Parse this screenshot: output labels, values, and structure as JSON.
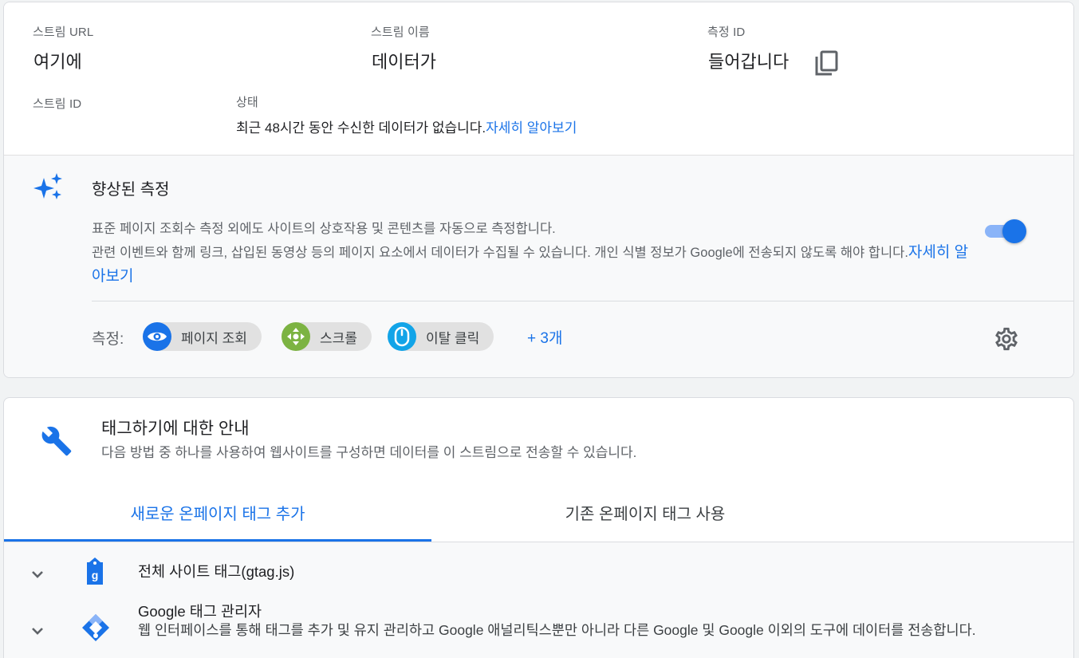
{
  "stream_details": {
    "url_label": "스트림 URL",
    "url_value": "여기에",
    "name_label": "스트림 이름",
    "name_value": "데이터가",
    "measurement_id_label": "측정 ID",
    "measurement_id_value": "들어갑니다",
    "copy_icon": "copy-icon",
    "stream_id_label": "스트림 ID",
    "status_label": "상태",
    "status_text": "최근 48시간 동안 수신한 데이터가 없습니다.",
    "status_link": "자세히 알아보기"
  },
  "enhanced_measurement": {
    "icon": "sparkle-icon",
    "title": "향상된 측정",
    "description_line1": "표준 페이지 조회수 측정 외에도 사이트의 상호작용 및 콘텐츠를 자동으로 측정합니다.",
    "description_line2": "관련 이벤트와 함께 링크, 삽입된 동영상 등의 페이지 요소에서 데이터가 수집될 수 있습니다. 개인 식별 정보가 Google에 전송되지 않도록 해야 합니다.",
    "learn_more": "자세히 알아보기",
    "toggle_on": true,
    "accent_color": "#1a73e8",
    "measurement_label": "측정:",
    "chips": [
      {
        "label": "페이지 조회",
        "icon": "eye-icon",
        "color": "#1a73e8"
      },
      {
        "label": "스크롤",
        "icon": "scroll-icon",
        "color": "#7cb342"
      },
      {
        "label": "이탈 클릭",
        "icon": "mouse-icon",
        "color": "#12a4e8"
      }
    ],
    "more": "+ 3개",
    "settings_icon": "gear-icon"
  },
  "tagging": {
    "icon": "wrench-icon",
    "title": "태그하기에 대한 안내",
    "subtitle": "다음 방법 중 하나를 사용하여 웹사이트를 구성하면 데이터를 이 스트림으로 전송할 수 있습니다.",
    "tabs": [
      {
        "label": "새로운 온페이지 태그 추가",
        "active": true
      },
      {
        "label": "기존 온페이지 태그 사용",
        "active": false
      }
    ],
    "items": [
      {
        "title": "전체 사이트 태그(gtag.js)",
        "icon": "gtag-icon",
        "description": ""
      },
      {
        "title": "Google 태그 관리자",
        "icon": "tag-manager-icon",
        "description": "웹 인터페이스를 통해 태그를 추가 및 유지 관리하고 Google 애널리틱스뿐만 아니라 다른 Google 및 Google 이외의 도구에 데이터를 전송합니다."
      }
    ]
  }
}
